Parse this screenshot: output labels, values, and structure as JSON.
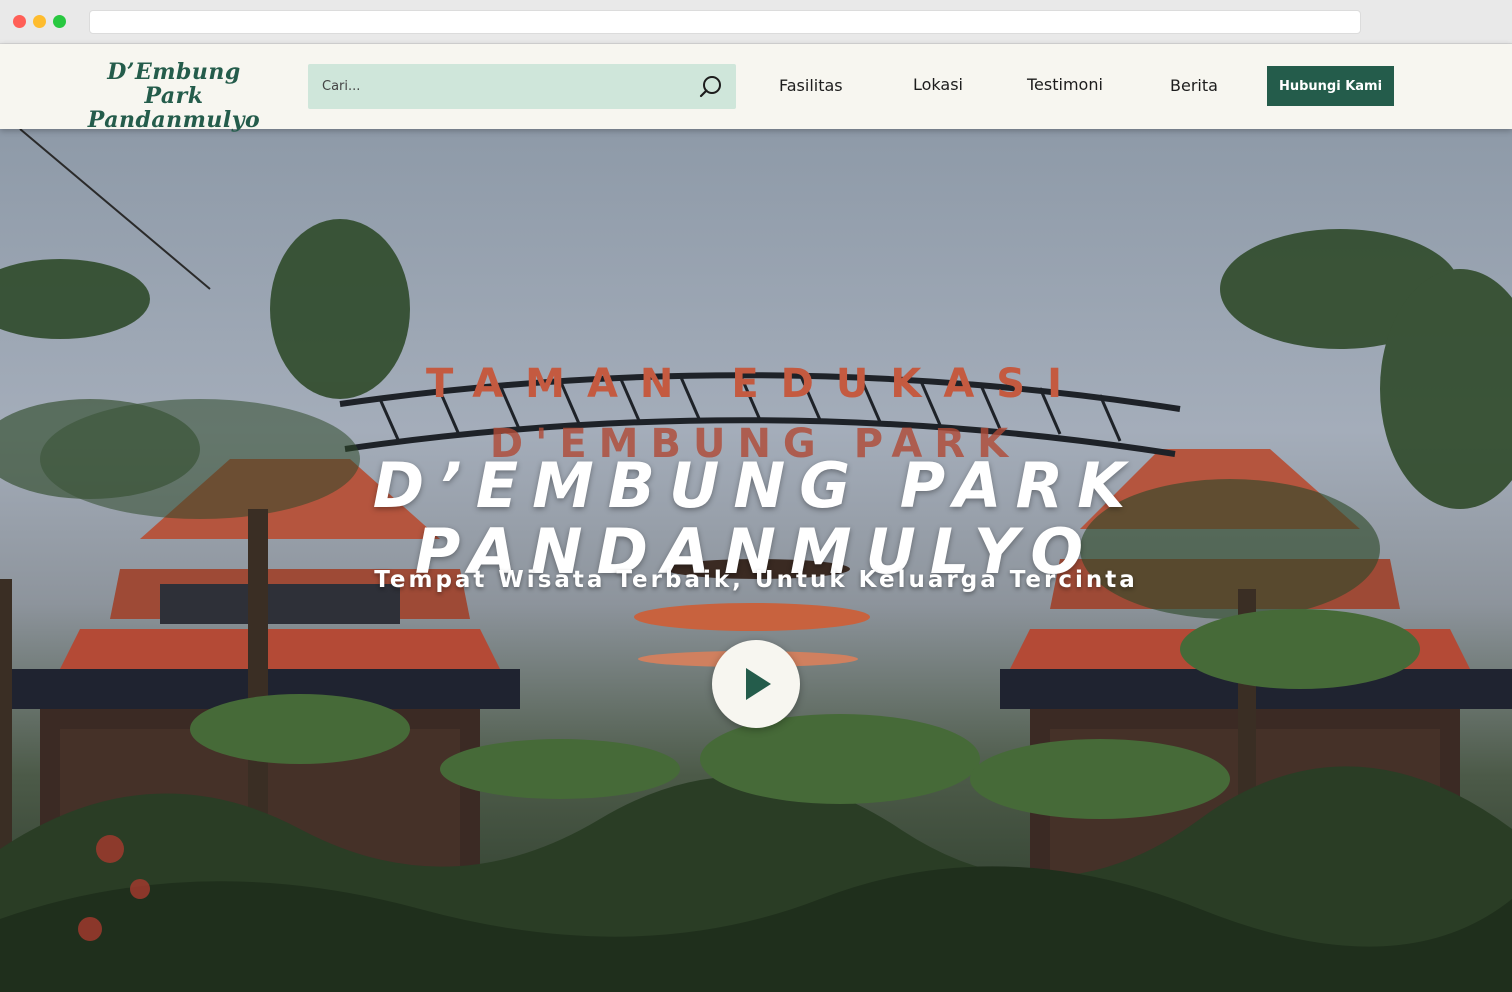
{
  "brand": {
    "name_line1": "D’Embung Park",
    "name_line2": "Pandanmulyo",
    "color_primary": "#245c4b",
    "color_search_bg": "#cfe6da",
    "color_header_bg": "#f7f6f0"
  },
  "search": {
    "placeholder": "Cari...",
    "icon": "search-icon"
  },
  "nav": {
    "items": [
      {
        "label": "Fasilitas"
      },
      {
        "label": "Lokasi"
      },
      {
        "label": "Testimoni"
      },
      {
        "label": "Berita"
      }
    ],
    "cta_label": "Hubungi Kami"
  },
  "hero": {
    "title_line1": "D’EMBUNG PARK",
    "title_line2": "PANDANMULYO",
    "subtitle": "Tempat Wisata Terbaik, Untuk Keluarga Tercinta",
    "play_icon": "play-icon",
    "gate_sign_top": "TAMAN EDUKASI",
    "gate_sign_bottom": "D'EMBUNG PARK"
  }
}
